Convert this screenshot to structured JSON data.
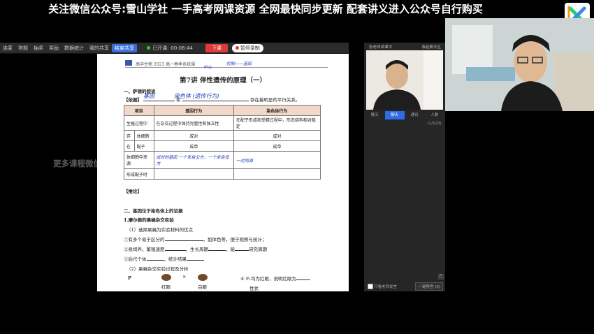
{
  "banner": {
    "text": "关注微信公众号:雪山学社 一手高考网课资源 全网最快同步更新 配套讲义进入公众号自行购买"
  },
  "toolbar": {
    "items": [
      "连麦",
      "答题",
      "抽奖",
      "奖励",
      "数据统计",
      "我的共享",
      "结束共享"
    ],
    "status": "已开课:",
    "time": "00:06:44",
    "down_label": "下课",
    "pause_label": "暂停录制"
  },
  "doc": {
    "header": "高中生物 2023 高一春季系统课",
    "title": "第7讲  伴性遗传的原理（一）",
    "sec1": "一、萨顿的假说",
    "basis_label": "【依据】",
    "basis_and": "和",
    "basis_tail": "存在着明显的平行关系。",
    "table": {
      "headers": [
        "项目",
        "基因行为",
        "染色体行为"
      ],
      "rows": [
        {
          "a": "生殖过程中",
          "b": "",
          "c": "在杂交过程中保持完整性和独立性",
          "d": "在配子形成和受精过程中，形态结构相对稳定"
        },
        {
          "a": "存",
          "b": "体细胞",
          "c": "成对",
          "d": "成对"
        },
        {
          "a": "在",
          "b": "配子",
          "c": "成单",
          "d": "成单"
        },
        {
          "a": "体细胞中来源",
          "b": "",
          "c": "",
          "d": ""
        },
        {
          "a": "形成配子时",
          "b": "",
          "c": "",
          "d": ""
        }
      ]
    },
    "infer": "【推论】",
    "sec2": "二、基因位于染色体上的证据",
    "sub1": "1.摩尔根的果蝇杂交实验",
    "p1": "（1）选择果蝇为实验材料的优点",
    "p2": "①有多个易于区分的",
    "p2b": "，如体色等，便于观察与统计；",
    "p3": "②易饲养，繁殖速度",
    "p3b": "，生长周期",
    "p3c": "，能",
    "p3d": "研究周期",
    "p4": "③后代个体",
    "p4b": "，统计结果",
    "p5": "（2）果蝇杂交实验过程及分析",
    "p_label": "P",
    "red_eye": "红眼",
    "white_eye": "白眼",
    "cross": "×",
    "note4": "④ F₁均为红眼，说明红眼为",
    "note4b": "性状"
  },
  "handwriting": {
    "gene": "基因",
    "chromo": "染色体 (遗传行为)",
    "top1": "中心",
    "top2": "控制——基因",
    "r4b": "成对的基因 一个来自父方，一个来自母方",
    "r4c": "一对同源"
  },
  "right_panel": {
    "top_left": "张老师讲课中",
    "top_right": "收起聊天区",
    "tabs": [
      "聊天",
      "聊天",
      "通讯",
      "人数(1/123)"
    ],
    "bottom_left": "只看老师发言",
    "bottom_right": "一键禁言 (0)"
  },
  "watermark": "更多课程微信: ns..."
}
